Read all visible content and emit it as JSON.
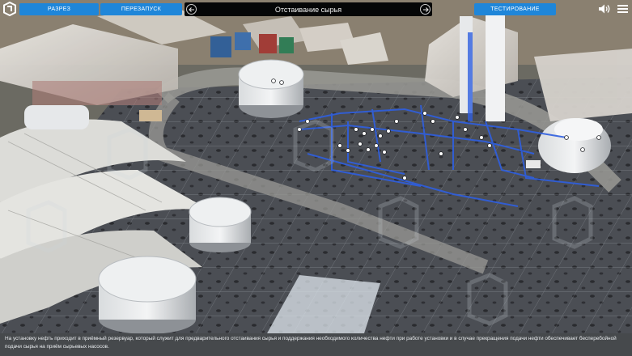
{
  "toolbar": {
    "cut_label": "РАЗРЕЗ",
    "restart_label": "ПЕРЕЗАПУСК",
    "test_label": "ТЕСТИРОВАНИЕ"
  },
  "step": {
    "title": "Отстаивание сырья"
  },
  "caption": {
    "text": "На установку нефть приходит в приёмный резервуар, который служит для предварительного отстаивания сырья и поддержания необходимого количества нефти при работе установки и в случае прекращения подачи нефти обеспечивает бесперебойной подачи сырья на приём сырьевых насосов."
  },
  "colors": {
    "accent": "#1f86d9",
    "pipe": "#2f5fe0",
    "step_bar": "#050607"
  },
  "icons": {
    "logo": "app-logo-icon",
    "prev": "arrow-left-icon",
    "next": "arrow-right-icon",
    "sound": "speaker-icon",
    "menu": "hamburger-menu-icon"
  }
}
